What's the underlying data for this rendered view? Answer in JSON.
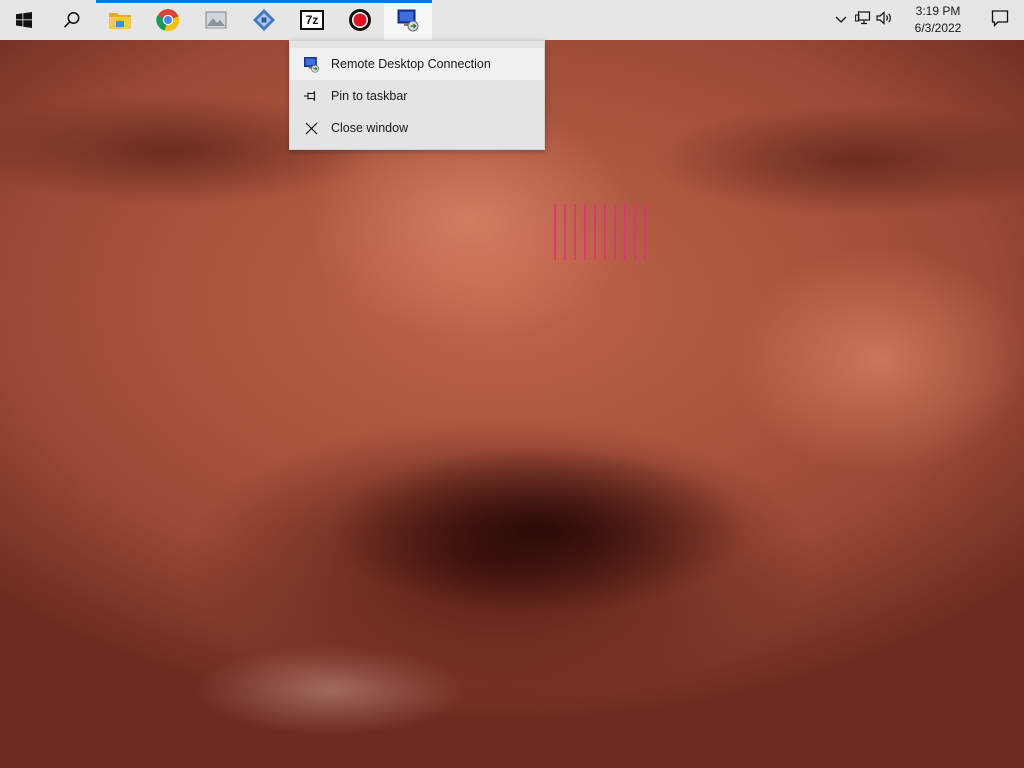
{
  "taskbar": {
    "apps": [
      {
        "icon": "windows-start-icon",
        "running": false
      },
      {
        "icon": "search-icon",
        "running": false
      },
      {
        "icon": "file-explorer-icon",
        "running": true
      },
      {
        "icon": "chrome-icon",
        "running": true
      },
      {
        "icon": "photo-viewer-icon",
        "running": true
      },
      {
        "icon": "settings-app-icon",
        "running": true
      },
      {
        "icon": "7zip-icon",
        "label": "7z",
        "running": true
      },
      {
        "icon": "record-icon",
        "running": true
      },
      {
        "icon": "remote-desktop-icon",
        "running": true,
        "active": true
      }
    ],
    "tray": {
      "chevron_icon": "chevron-up-icon",
      "network_icon": "network-icon",
      "volume_icon": "volume-icon",
      "time": "3:19 PM",
      "date": "6/3/2022",
      "notification_icon": "notification-icon"
    },
    "accent_color": "#0078d7"
  },
  "jumplist": {
    "items": [
      {
        "label": "Remote Desktop Connection",
        "icon": "remote-desktop-icon"
      },
      {
        "label": "Pin to taskbar",
        "icon": "pin-icon"
      },
      {
        "label": "Close window",
        "icon": "close-icon"
      }
    ]
  }
}
